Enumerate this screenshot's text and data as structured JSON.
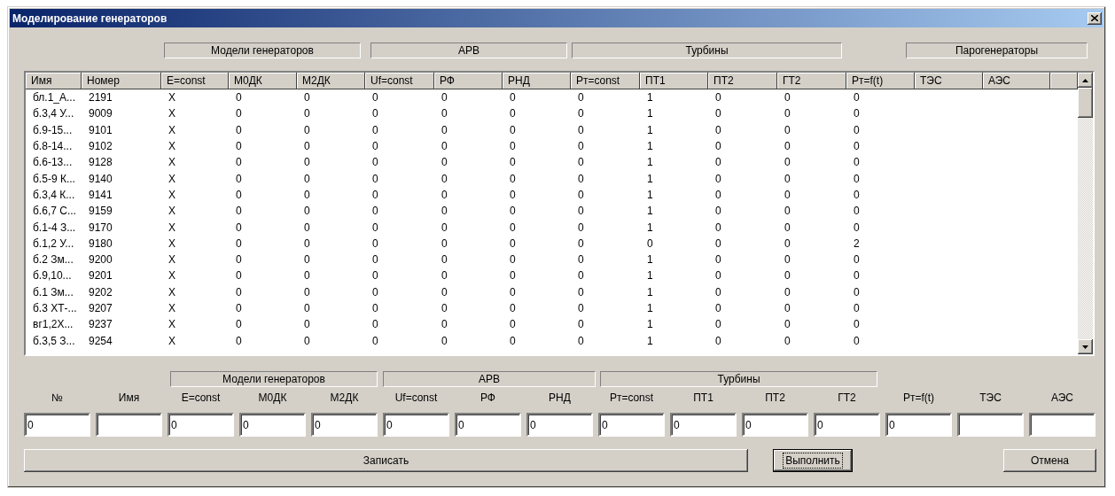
{
  "window": {
    "title": "Моделирование генераторов"
  },
  "table": {
    "groups": [
      {
        "label": "Модели генераторов"
      },
      {
        "label": "АРВ"
      },
      {
        "label": "Турбины"
      },
      {
        "label": "Парогенераторы"
      }
    ],
    "columns": [
      "Имя",
      "Номер",
      "E=const",
      "М0ДК",
      "М2ДК",
      "Uf=const",
      "РФ",
      "РНД",
      "Рт=const",
      "ПТ1",
      "ПТ2",
      "ГТ2",
      "Рт=f(t)",
      "ТЭС",
      "АЭС"
    ],
    "rows": [
      {
        "cells": [
          "бл.1_А...",
          "2191",
          "X",
          "0",
          "0",
          "0",
          "0",
          "0",
          "0",
          "1",
          "0",
          "0",
          "0"
        ]
      },
      {
        "cells": [
          "б.3,4 У...",
          "9009",
          "X",
          "0",
          "0",
          "0",
          "0",
          "0",
          "0",
          "1",
          "0",
          "0",
          "0"
        ]
      },
      {
        "cells": [
          "б.9-15...",
          "9101",
          "X",
          "0",
          "0",
          "0",
          "0",
          "0",
          "0",
          "1",
          "0",
          "0",
          "0"
        ]
      },
      {
        "cells": [
          "б.8-14...",
          "9102",
          "X",
          "0",
          "0",
          "0",
          "0",
          "0",
          "0",
          "1",
          "0",
          "0",
          "0"
        ]
      },
      {
        "cells": [
          "б.6-13...",
          "9128",
          "X",
          "0",
          "0",
          "0",
          "0",
          "0",
          "0",
          "1",
          "0",
          "0",
          "0"
        ]
      },
      {
        "cells": [
          "б.5-9 К...",
          "9140",
          "X",
          "0",
          "0",
          "0",
          "0",
          "0",
          "0",
          "1",
          "0",
          "0",
          "0"
        ]
      },
      {
        "cells": [
          "б.3,4 К...",
          "9141",
          "X",
          "0",
          "0",
          "0",
          "0",
          "0",
          "0",
          "1",
          "0",
          "0",
          "0"
        ]
      },
      {
        "cells": [
          "б.6,7 С...",
          "9159",
          "X",
          "0",
          "0",
          "0",
          "0",
          "0",
          "0",
          "1",
          "0",
          "0",
          "0"
        ]
      },
      {
        "cells": [
          "б.1-4 З...",
          "9170",
          "X",
          "0",
          "0",
          "0",
          "0",
          "0",
          "0",
          "1",
          "0",
          "0",
          "0"
        ]
      },
      {
        "cells": [
          "б.1,2 У...",
          "9180",
          "X",
          "0",
          "0",
          "0",
          "0",
          "0",
          "0",
          "0",
          "0",
          "0",
          "2"
        ]
      },
      {
        "cells": [
          "б.2 Зм...",
          "9200",
          "X",
          "0",
          "0",
          "0",
          "0",
          "0",
          "0",
          "1",
          "0",
          "0",
          "0"
        ]
      },
      {
        "cells": [
          "б.9,10...",
          "9201",
          "X",
          "0",
          "0",
          "0",
          "0",
          "0",
          "0",
          "1",
          "0",
          "0",
          "0"
        ]
      },
      {
        "cells": [
          "б.1 Зм...",
          "9202",
          "X",
          "0",
          "0",
          "0",
          "0",
          "0",
          "0",
          "1",
          "0",
          "0",
          "0"
        ]
      },
      {
        "cells": [
          "б.3 ХТ-...",
          "9207",
          "X",
          "0",
          "0",
          "0",
          "0",
          "0",
          "0",
          "1",
          "0",
          "0",
          "0"
        ]
      },
      {
        "cells": [
          "вг1,2Х...",
          "9237",
          "X",
          "0",
          "0",
          "0",
          "0",
          "0",
          "0",
          "1",
          "0",
          "0",
          "0"
        ]
      },
      {
        "cells": [
          "б.3,5 З...",
          "9254",
          "X",
          "0",
          "0",
          "0",
          "0",
          "0",
          "0",
          "1",
          "0",
          "0",
          "0"
        ]
      }
    ]
  },
  "editor": {
    "groups": [
      {
        "label": "Модели генераторов"
      },
      {
        "label": "АРВ"
      },
      {
        "label": "Турбины"
      }
    ],
    "fields": [
      {
        "label": "№",
        "value": "0"
      },
      {
        "label": "Имя"
      },
      {
        "label": "E=const",
        "value": "0"
      },
      {
        "label": "М0ДК",
        "value": "0"
      },
      {
        "label": "М2ДК",
        "value": "0"
      },
      {
        "label": "Uf=const",
        "value": "0"
      },
      {
        "label": "РФ",
        "value": "0"
      },
      {
        "label": "РНД",
        "value": "0"
      },
      {
        "label": "Рт=const",
        "value": "0"
      },
      {
        "label": "ПТ1",
        "value": "0"
      },
      {
        "label": "ПТ2",
        "value": "0"
      },
      {
        "label": "ГТ2",
        "value": "0"
      },
      {
        "label": "Рт=f(t)",
        "value": "0"
      },
      {
        "label": "ТЭС"
      },
      {
        "label": "АЭС"
      }
    ]
  },
  "buttons": [
    {
      "label": "Записать",
      "focused": false
    },
    {
      "label": "Выполнить",
      "focused": true
    },
    {
      "label": "Отмена",
      "focused": false
    }
  ]
}
